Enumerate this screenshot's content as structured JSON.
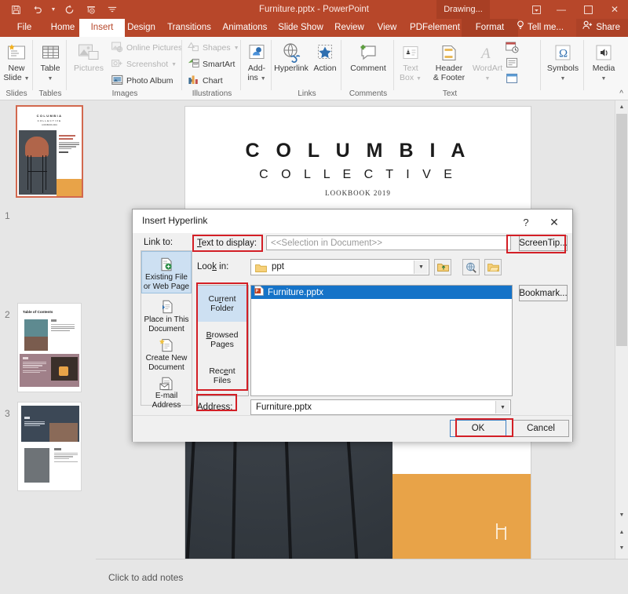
{
  "titlebar": {
    "document_title": "Furniture.pptx - PowerPoint",
    "contextual_tab_group": "Drawing...",
    "quick_access": [
      {
        "name": "save-icon",
        "label": "Save"
      },
      {
        "name": "undo-icon",
        "label": "Undo"
      },
      {
        "name": "redo-icon",
        "label": "Redo"
      },
      {
        "name": "start-slideshow-icon",
        "label": "Start From Beginning"
      },
      {
        "name": "customize-qat-icon",
        "label": "Customize Quick Access Toolbar"
      }
    ],
    "window_controls": [
      {
        "name": "ribbon-display-options-icon",
        "glyph": "❐"
      },
      {
        "name": "minimize-icon",
        "glyph": "─"
      },
      {
        "name": "restore-icon",
        "glyph": "❐"
      },
      {
        "name": "close-icon",
        "glyph": "✕"
      }
    ]
  },
  "tabs": [
    {
      "label": "File",
      "active": false,
      "context": false
    },
    {
      "label": "Home",
      "active": false,
      "context": false
    },
    {
      "label": "Insert",
      "active": true,
      "context": false
    },
    {
      "label": "Design",
      "active": false,
      "context": false
    },
    {
      "label": "Transitions",
      "active": false,
      "context": false
    },
    {
      "label": "Animations",
      "active": false,
      "context": false
    },
    {
      "label": "Slide Show",
      "active": false,
      "context": false
    },
    {
      "label": "Review",
      "active": false,
      "context": false
    },
    {
      "label": "View",
      "active": false,
      "context": false
    },
    {
      "label": "PDFelement",
      "active": false,
      "context": false
    },
    {
      "label": "Format",
      "active": false,
      "context": true
    }
  ],
  "tell_me": "Tell me...",
  "share": "Share",
  "ribbon": {
    "groups": [
      {
        "name": "slides",
        "label": "Slides",
        "buttons": [
          {
            "label": "New\nSlide",
            "caret": true
          }
        ]
      },
      {
        "name": "tables",
        "label": "Tables",
        "buttons": [
          {
            "label": "Table",
            "caret": true
          }
        ]
      },
      {
        "name": "images",
        "label": "Images",
        "big": [
          {
            "label": "Pictures",
            "disabled": true
          }
        ],
        "small": [
          {
            "label": "Online Pictures",
            "disabled": true,
            "caret": false
          },
          {
            "label": "Screenshot",
            "disabled": true,
            "caret": true
          },
          {
            "label": "Photo Album",
            "disabled": false,
            "caret": true
          }
        ]
      },
      {
        "name": "illustrations",
        "label": "Illustrations",
        "small": [
          {
            "label": "Shapes",
            "disabled": true,
            "caret": true
          },
          {
            "label": "SmartArt",
            "disabled": false,
            "caret": false
          },
          {
            "label": "Chart",
            "disabled": false,
            "caret": false
          }
        ]
      },
      {
        "name": "addins",
        "label": "",
        "buttons": [
          {
            "label": "Add-\nins",
            "caret": true
          }
        ]
      },
      {
        "name": "links",
        "label": "Links",
        "big": [
          {
            "label": "Hyperlink"
          },
          {
            "label": "Action"
          }
        ]
      },
      {
        "name": "comments",
        "label": "Comments",
        "big": [
          {
            "label": "Comment"
          }
        ]
      },
      {
        "name": "text",
        "label": "Text",
        "big": [
          {
            "label": "Text\nBox",
            "caret": true,
            "disabled": true
          },
          {
            "label": "Header\n& Footer"
          },
          {
            "label": "WordArt",
            "caret": true,
            "disabled": true
          }
        ]
      },
      {
        "name": "symbols",
        "label": "",
        "buttons": [
          {
            "label": "Symbols",
            "caret": true
          }
        ]
      },
      {
        "name": "media",
        "label": "",
        "buttons": [
          {
            "label": "Media",
            "caret": true
          }
        ]
      }
    ],
    "collapse_label": "^"
  },
  "slide_panel": {
    "thumbnails": [
      {
        "number": "1",
        "selected": true,
        "title": ""
      },
      {
        "number": "2",
        "selected": false,
        "title": "Table of Contents"
      },
      {
        "number": "3",
        "selected": false,
        "title": ""
      }
    ]
  },
  "slide": {
    "title": "C O L U M B I A",
    "subtitle": "C O L L E C T I V E",
    "caption": "LOOKBOOK 2019",
    "accent_color": "#e8a348",
    "photo_color": "#3c4248"
  },
  "notes": {
    "placeholder": "Click to add notes"
  },
  "dialog": {
    "title": "Insert Hyperlink",
    "help_glyph": "?",
    "close_glyph": "✕",
    "link_to_label": "Link to:",
    "link_to_items": [
      {
        "label": "Existing File\nor Web Page",
        "selected": true,
        "icon": "existing-file-icon"
      },
      {
        "label": "Place in This\nDocument",
        "selected": false,
        "icon": "place-in-document-icon"
      },
      {
        "label": "Create New\nDocument",
        "selected": false,
        "icon": "create-new-document-icon"
      },
      {
        "label": "E-mail\nAddress",
        "selected": false,
        "icon": "email-address-icon"
      }
    ],
    "text_to_display_label": "Text to display:",
    "text_to_display_value": "<<Selection in Document>>",
    "screentip_button": "ScreenTip...",
    "look_in_label": "Look in:",
    "look_in_value": "ppt",
    "toolbar_icons": [
      {
        "name": "up-one-folder-icon"
      },
      {
        "name": "browse-the-web-icon"
      },
      {
        "name": "browse-for-file-icon"
      }
    ],
    "folder_tabs": [
      {
        "label": "Current\nFolder",
        "selected": true
      },
      {
        "label": "Browsed\nPages",
        "selected": false
      },
      {
        "label": "Recent\nFiles",
        "selected": false
      }
    ],
    "files": [
      {
        "name": "Furniture.pptx",
        "selected": true
      }
    ],
    "bookmark_button": "Bookmark...",
    "address_label": "Address:",
    "address_value": "Furniture.pptx",
    "ok_button": "OK",
    "cancel_button": "Cancel"
  },
  "highlight_color": "#d31f26"
}
